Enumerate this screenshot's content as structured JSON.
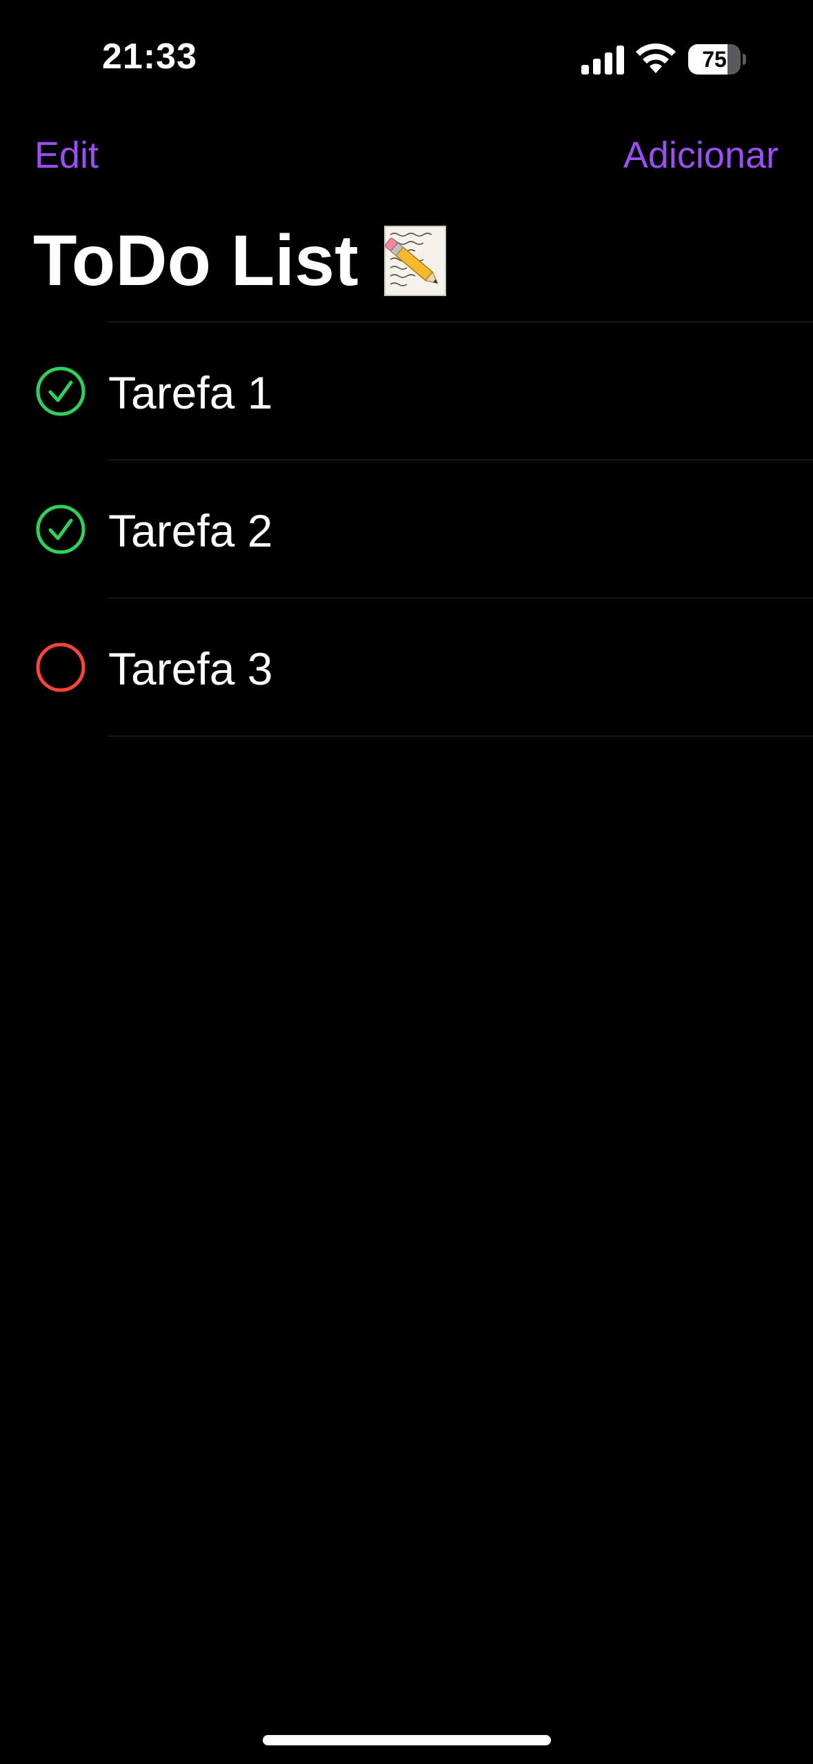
{
  "status_bar": {
    "time": "21:33",
    "battery_level": "75",
    "battery_fraction": 0.75
  },
  "nav": {
    "edit_label": "Edit",
    "add_label": "Adicionar"
  },
  "title": {
    "text": "ToDo List",
    "emoji_icon": "memo-icon"
  },
  "tasks": [
    {
      "label": "Tarefa 1",
      "done": true
    },
    {
      "label": "Tarefa 2",
      "done": true
    },
    {
      "label": "Tarefa 3",
      "done": false
    }
  ],
  "colors": {
    "accent": "#9b4ff2",
    "done": "#30d158",
    "pending": "#ff453a",
    "background": "#000000",
    "separator": "#2c2c2e"
  }
}
